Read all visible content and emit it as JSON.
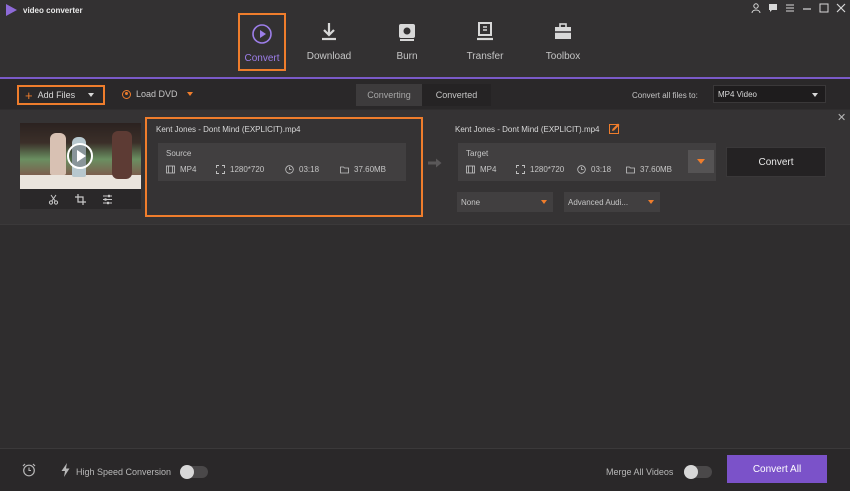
{
  "app": {
    "title": "video converter"
  },
  "nav": {
    "items": [
      {
        "label": "Convert",
        "icon": "convert-icon",
        "active": true
      },
      {
        "label": "Download",
        "icon": "download-icon",
        "active": false
      },
      {
        "label": "Burn",
        "icon": "burn-icon",
        "active": false
      },
      {
        "label": "Transfer",
        "icon": "transfer-icon",
        "active": false
      },
      {
        "label": "Toolbox",
        "icon": "toolbox-icon",
        "active": false
      }
    ]
  },
  "toolbar": {
    "add_files": "Add Files",
    "load_dvd": "Load DVD",
    "tabs": [
      "Converting",
      "Converted"
    ],
    "convert_all_label": "Convert all files to:",
    "format": "MP4 Video"
  },
  "file": {
    "name_source": "Kent Jones - Dont Mind (EXPLICIT).mp4",
    "name_target": "Kent Jones - Dont Mind (EXPLICIT).mp4",
    "source": {
      "title": "Source",
      "format": "MP4",
      "resolution": "1280*720",
      "duration": "03:18",
      "size": "37.60MB"
    },
    "target": {
      "title": "Target",
      "format": "MP4",
      "resolution": "1280*720",
      "duration": "03:18",
      "size": "37.60MB"
    },
    "subtitle_select": "None",
    "audio_select": "Advanced Audi...",
    "convert_button": "Convert"
  },
  "footer": {
    "high_speed": "High Speed Conversion",
    "merge": "Merge All Videos",
    "convert_all": "Convert All"
  },
  "colors": {
    "accent": "#ef7d2c",
    "brand": "#7b52c9",
    "nav_active": "#9d7ee9"
  }
}
